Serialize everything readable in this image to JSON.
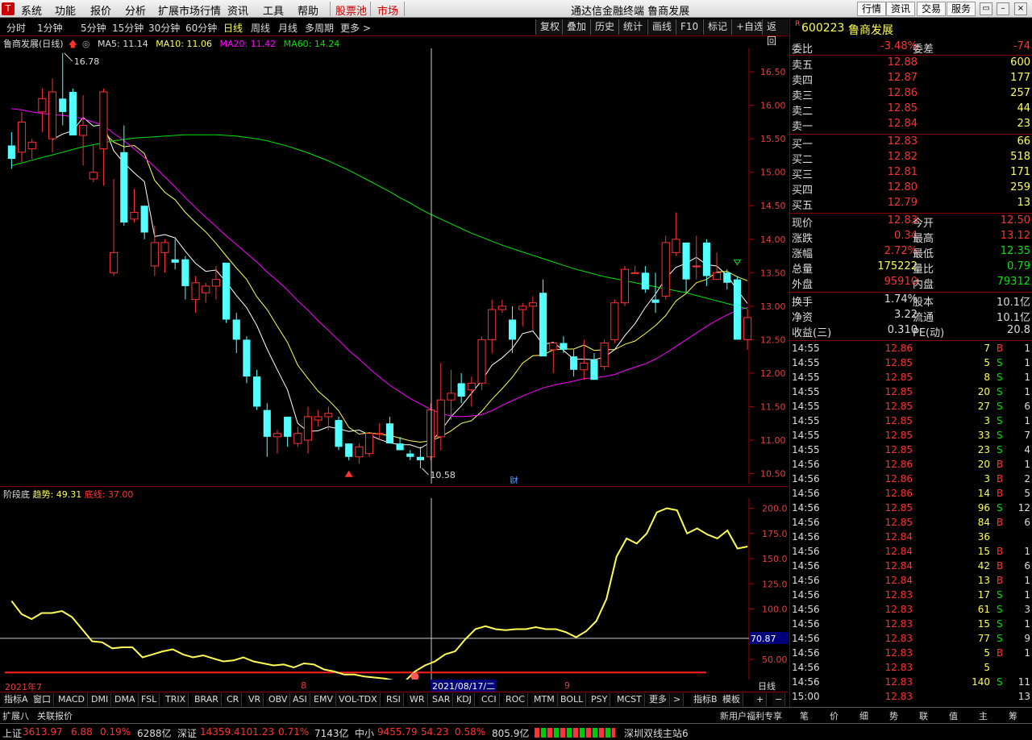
{
  "menu": {
    "items": [
      "系统",
      "功能",
      "报价",
      "分析",
      "扩展市场行情",
      "资讯",
      "工具",
      "帮助"
    ],
    "hl": [
      "股票池",
      "市场"
    ],
    "app_title": "通达信金融终端  鲁商发展",
    "right_btns": [
      "行情",
      "资讯",
      "交易",
      "服务"
    ]
  },
  "periods": [
    "分时",
    "1分钟",
    "5分钟",
    "15分钟",
    "30分钟",
    "60分钟",
    "日线",
    "周线",
    "月线",
    "多周期",
    "更多 >"
  ],
  "tools": [
    "复权",
    "叠加",
    "历史",
    "统计",
    "画线",
    "F10",
    "标记",
    "+自选",
    "返回"
  ],
  "legend": {
    "name": "鲁商发展(日线)",
    "ma5": "MA5: 11.14",
    "ma10": "MA10: 11.06",
    "ma20": "MA20: 11.42",
    "ma60": "MA60: 14.24"
  },
  "kaxis": [
    "16.50",
    "16.00",
    "15.50",
    "15.00",
    "14.50",
    "14.00",
    "13.50",
    "13.00",
    "12.50",
    "12.00",
    "11.50",
    "11.00",
    "10.50"
  ],
  "ann": {
    "high": "16.78",
    "low": "10.58",
    "cai": "财"
  },
  "ind": {
    "name": "阶段底",
    "trend": "趋势: 49.31",
    "base": "底线: 37.00",
    "axis": [
      "200.0",
      "175.0",
      "150.0",
      "125.0",
      "100.0",
      "50.00"
    ],
    "cur": "70.87"
  },
  "xaxis": {
    "a": "2021年7",
    "b": "8",
    "c": "9",
    "cursor": "2021/08/17/二",
    "period": "日线"
  },
  "bottom_tabs": [
    "指标A",
    "窗口",
    "MACD",
    "DMI",
    "DMA",
    "FSL",
    "TRIX",
    "BRAR",
    "CR",
    "VR",
    "OBV",
    "ASI",
    "EMV",
    "VOL-TDX",
    "RSI",
    "WR",
    "SAR",
    "KDJ",
    "CCI",
    "ROC",
    "MTM",
    "BOLL",
    "PSY",
    "MCST",
    "更多",
    "指标B",
    "模板"
  ],
  "status_tabs": [
    "扩展八",
    "关联报价",
    "新用户福利专享",
    "笔",
    "价",
    "细",
    "势",
    "联",
    "值",
    "主",
    "筹"
  ],
  "index_bar": [
    {
      "n": "上证",
      "v": "3613.97",
      "c": "6.88",
      "p": "0.19%",
      "a": "6288亿"
    },
    {
      "n": "深证",
      "v": "14359.4",
      "c": "101.23",
      "p": "0.71%",
      "a": "7143亿"
    },
    {
      "n": "中小",
      "v": "9455.79",
      "c": "54.23",
      "p": "0.58%",
      "a": "805.9亿"
    }
  ],
  "server": "深圳双线主站6",
  "stock": {
    "code": "600223",
    "name": "鲁商发展",
    "r": "R"
  },
  "wei": {
    "l": "委比",
    "v": "-3.48%",
    "l2": "委差",
    "v2": "-74"
  },
  "asks": [
    {
      "l": "卖五",
      "p": "12.88",
      "q": "600"
    },
    {
      "l": "卖四",
      "p": "12.87",
      "q": "177"
    },
    {
      "l": "卖三",
      "p": "12.86",
      "q": "257"
    },
    {
      "l": "卖二",
      "p": "12.85",
      "q": "44"
    },
    {
      "l": "卖一",
      "p": "12.84",
      "q": "23"
    }
  ],
  "bids": [
    {
      "l": "买一",
      "p": "12.83",
      "q": "66"
    },
    {
      "l": "买二",
      "p": "12.82",
      "q": "518"
    },
    {
      "l": "买三",
      "p": "12.81",
      "q": "171"
    },
    {
      "l": "买四",
      "p": "12.80",
      "q": "259"
    },
    {
      "l": "买五",
      "p": "12.79",
      "q": "13"
    }
  ],
  "quote": [
    {
      "l": "现价",
      "v": "12.83",
      "c": "red",
      "l2": "今开",
      "v2": "12.50",
      "c2": "red"
    },
    {
      "l": "涨跌",
      "v": "0.34",
      "c": "red",
      "l2": "最高",
      "v2": "13.12",
      "c2": "red"
    },
    {
      "l": "涨幅",
      "v": "2.72%",
      "c": "red",
      "l2": "最低",
      "v2": "12.35",
      "c2": "green"
    },
    {
      "l": "总量",
      "v": "175222",
      "c": "yel",
      "l2": "量比",
      "v2": "0.79",
      "c2": "green"
    },
    {
      "l": "外盘",
      "v": "95910",
      "c": "red",
      "l2": "内盘",
      "v2": "79312",
      "c2": "green"
    }
  ],
  "fin": [
    {
      "l": "换手",
      "v": "1.74%",
      "l2": "股本",
      "v2": "10.1亿"
    },
    {
      "l": "净资",
      "v": "3.22",
      "l2": "流通",
      "v2": "10.1亿"
    },
    {
      "l": "收益(三)",
      "v": "0.310",
      "l2": "PE(动)",
      "v2": "20.8"
    }
  ],
  "ticks": [
    [
      "14:55",
      "12.86",
      "7",
      "B",
      "1"
    ],
    [
      "14:55",
      "12.85",
      "5",
      "S",
      "1"
    ],
    [
      "14:55",
      "12.85",
      "8",
      "S",
      "1"
    ],
    [
      "14:55",
      "12.85",
      "20",
      "S",
      "1"
    ],
    [
      "14:55",
      "12.85",
      "27",
      "S",
      "6"
    ],
    [
      "14:55",
      "12.85",
      "3",
      "S",
      "1"
    ],
    [
      "14:55",
      "12.85",
      "33",
      "S",
      "7"
    ],
    [
      "14:55",
      "12.85",
      "23",
      "S",
      "4"
    ],
    [
      "14:56",
      "12.86",
      "20",
      "B",
      "1"
    ],
    [
      "14:56",
      "12.86",
      "3",
      "B",
      "2"
    ],
    [
      "14:56",
      "12.86",
      "14",
      "B",
      "5"
    ],
    [
      "14:56",
      "12.85",
      "96",
      "S",
      "12"
    ],
    [
      "14:56",
      "12.85",
      "84",
      "B",
      "6"
    ],
    [
      "14:56",
      "12.84",
      "36",
      "",
      ""
    ],
    [
      "14:56",
      "12.84",
      "15",
      "B",
      "1"
    ],
    [
      "14:56",
      "12.84",
      "42",
      "B",
      "6"
    ],
    [
      "14:56",
      "12.84",
      "13",
      "B",
      "1"
    ],
    [
      "14:56",
      "12.83",
      "17",
      "S",
      "1"
    ],
    [
      "14:56",
      "12.83",
      "61",
      "S",
      "3"
    ],
    [
      "14:56",
      "12.83",
      "15",
      "S",
      "1"
    ],
    [
      "14:56",
      "12.83",
      "77",
      "S",
      "9"
    ],
    [
      "14:56",
      "12.83",
      "5",
      "B",
      "1"
    ],
    [
      "14:56",
      "12.83",
      "5",
      "",
      ""
    ],
    [
      "14:56",
      "12.83",
      "140",
      "S",
      "11"
    ],
    [
      "15:00",
      "12.83",
      "",
      "",
      "13"
    ]
  ],
  "chart_data": [
    {
      "type": "candlestick",
      "title": "鲁商发展(日线)",
      "ylim": [
        10.35,
        16.85
      ],
      "candles": [
        [
          15.4,
          15.6,
          15.05,
          15.2
        ],
        [
          15.3,
          15.9,
          15.15,
          15.75
        ],
        [
          15.35,
          15.5,
          15.2,
          15.45
        ],
        [
          15.9,
          16.25,
          15.6,
          16.1
        ],
        [
          15.5,
          16.4,
          15.3,
          16.2
        ],
        [
          16.1,
          16.78,
          15.7,
          15.9
        ],
        [
          16.2,
          16.25,
          15.6,
          15.55
        ],
        [
          15.55,
          16.15,
          15.1,
          15.7
        ],
        [
          14.9,
          15.4,
          14.85,
          15.0
        ],
        [
          15.35,
          16.25,
          14.8,
          16.2
        ],
        [
          13.5,
          14.9,
          13.45,
          13.8
        ],
        [
          15.3,
          15.7,
          14.2,
          14.25
        ],
        [
          14.3,
          14.75,
          14.25,
          14.4
        ],
        [
          14.5,
          14.5,
          14.0,
          14.1
        ],
        [
          13.6,
          14.2,
          13.45,
          13.95
        ],
        [
          13.8,
          14.0,
          13.5,
          13.95
        ],
        [
          13.7,
          14.0,
          13.55,
          13.65
        ],
        [
          13.7,
          13.75,
          13.1,
          13.3
        ],
        [
          13.1,
          13.45,
          12.9,
          13.35
        ],
        [
          13.2,
          13.35,
          13.05,
          13.3
        ],
        [
          13.3,
          13.6,
          13.1,
          13.4
        ],
        [
          13.65,
          13.65,
          12.75,
          12.8
        ],
        [
          12.8,
          12.9,
          12.3,
          12.5
        ],
        [
          12.5,
          12.55,
          11.85,
          11.95
        ],
        [
          11.95,
          12.05,
          11.45,
          11.5
        ],
        [
          11.45,
          11.55,
          10.75,
          11.05
        ],
        [
          11.05,
          11.15,
          10.8,
          11.1
        ],
        [
          11.35,
          11.3,
          10.9,
          11.05
        ],
        [
          10.95,
          11.2,
          10.9,
          11.1
        ],
        [
          11.0,
          11.5,
          10.8,
          11.35
        ],
        [
          11.3,
          11.45,
          11.2,
          11.35
        ],
        [
          11.35,
          11.5,
          11.15,
          11.4
        ],
        [
          11.3,
          11.35,
          10.85,
          10.9
        ],
        [
          10.95,
          10.95,
          10.7,
          10.75
        ],
        [
          10.75,
          10.95,
          10.65,
          10.9
        ],
        [
          10.8,
          11.1,
          10.75,
          11.1
        ],
        [
          11.1,
          11.25,
          11.0,
          11.1
        ],
        [
          11.25,
          11.35,
          10.95,
          10.95
        ],
        [
          10.95,
          11.05,
          10.85,
          10.85
        ],
        [
          10.8,
          10.85,
          10.7,
          10.75
        ],
        [
          10.75,
          10.9,
          10.58,
          10.7
        ],
        [
          10.75,
          11.55,
          10.7,
          11.45
        ],
        [
          11.05,
          12.15,
          10.85,
          11.6
        ],
        [
          11.6,
          12.05,
          11.3,
          11.7
        ],
        [
          11.85,
          12.0,
          11.55,
          11.65
        ],
        [
          11.75,
          11.95,
          11.5,
          11.85
        ],
        [
          11.85,
          12.55,
          11.75,
          12.5
        ],
        [
          12.5,
          13.1,
          12.3,
          12.95
        ],
        [
          12.95,
          13.1,
          12.9,
          13.0
        ],
        [
          12.8,
          13.0,
          12.3,
          12.5
        ],
        [
          12.95,
          13.05,
          12.7,
          13.0
        ],
        [
          13.0,
          13.15,
          12.65,
          13.05
        ],
        [
          13.2,
          13.4,
          12.3,
          12.25
        ],
        [
          12.35,
          12.45,
          12.0,
          12.45
        ],
        [
          12.45,
          12.55,
          12.3,
          12.35
        ],
        [
          12.25,
          12.35,
          11.95,
          12.05
        ],
        [
          12.05,
          12.5,
          11.9,
          12.15
        ],
        [
          12.2,
          12.3,
          11.95,
          11.9
        ],
        [
          12.1,
          12.5,
          12.05,
          12.45
        ],
        [
          12.5,
          13.1,
          12.45,
          13.05
        ],
        [
          13.05,
          13.6,
          13.0,
          13.55
        ],
        [
          13.5,
          13.6,
          13.5,
          13.5
        ],
        [
          13.5,
          13.6,
          13.2,
          13.25
        ],
        [
          13.1,
          13.5,
          12.9,
          13.05
        ],
        [
          13.15,
          14.05,
          13.1,
          13.95
        ],
        [
          13.8,
          14.4,
          13.75,
          14.0
        ],
        [
          13.95,
          13.95,
          13.2,
          13.4
        ],
        [
          13.6,
          14.05,
          13.4,
          13.6
        ],
        [
          13.95,
          14.0,
          13.3,
          13.45
        ],
        [
          13.4,
          13.8,
          13.4,
          13.5
        ],
        [
          13.5,
          13.55,
          13.25,
          13.35
        ],
        [
          13.4,
          13.45,
          12.5,
          12.5
        ],
        [
          12.5,
          12.95,
          12.35,
          12.83
        ]
      ],
      "series": [
        {
          "name": "MA5",
          "color": "#ffffff",
          "values": [
            null,
            null,
            null,
            null,
            15.49,
            15.57,
            15.62,
            15.82,
            15.69,
            15.71,
            15.32,
            15.14,
            14.99,
            14.86,
            14.04,
            14.07,
            14.02,
            13.82,
            13.64,
            13.52,
            13.54,
            13.36,
            13.16,
            12.98,
            12.71,
            12.36,
            12.05,
            11.75,
            11.25,
            11.13,
            11.14,
            11.2,
            11.17,
            11.13,
            11.15,
            11.08,
            11.01,
            10.96,
            10.93,
            10.93,
            10.88,
            10.97,
            11.14,
            11.35,
            11.51,
            11.7,
            11.89,
            12.12,
            12.23,
            12.37,
            12.59,
            12.63,
            12.43,
            12.46,
            12.34,
            12.21,
            12.21,
            12.2,
            12.24,
            12.35,
            12.56,
            12.74,
            12.98,
            13.18,
            13.42,
            13.58,
            13.64,
            13.73,
            13.62,
            13.6,
            13.46,
            13.24,
            13.04
          ]
        },
        {
          "name": "MA10",
          "color": "#ffff54",
          "values": [
            null,
            null,
            null,
            null,
            null,
            null,
            null,
            null,
            null,
            15.6,
            15.45,
            15.38,
            15.4,
            15.28,
            14.88,
            14.7,
            14.59,
            14.4,
            14.25,
            14.11,
            13.94,
            13.75,
            13.57,
            13.4,
            13.14,
            12.95,
            12.7,
            12.46,
            12.12,
            11.92,
            11.73,
            11.6,
            11.44,
            11.19,
            11.09,
            11.11,
            11.09,
            11.07,
            11.03,
            10.99,
            10.97,
            10.99,
            11.05,
            11.14,
            11.25,
            11.29,
            11.43,
            11.61,
            11.77,
            11.94,
            12.15,
            12.26,
            12.27,
            12.35,
            12.36,
            12.36,
            12.42,
            12.34,
            12.35,
            12.35,
            12.43,
            12.48,
            12.59,
            12.71,
            12.86,
            13.08,
            13.19,
            13.35,
            13.4,
            13.51,
            13.52,
            13.44,
            13.38
          ]
        },
        {
          "name": "MA20",
          "color": "#ff00ff",
          "values": [
            15.95,
            15.93,
            15.9,
            15.88,
            15.86,
            15.85,
            15.83,
            15.8,
            15.75,
            15.7,
            15.58,
            15.47,
            15.35,
            15.22,
            15.08,
            14.93,
            14.78,
            14.62,
            14.47,
            14.33,
            14.19,
            14.05,
            13.92,
            13.79,
            13.66,
            13.51,
            13.38,
            13.24,
            13.08,
            12.94,
            12.78,
            12.64,
            12.49,
            12.34,
            12.21,
            12.07,
            11.94,
            11.82,
            11.72,
            11.62,
            11.54,
            11.46,
            11.4,
            11.36,
            11.35,
            11.36,
            11.38,
            11.44,
            11.52,
            11.59,
            11.66,
            11.72,
            11.78,
            11.82,
            11.85,
            11.88,
            11.92,
            11.93,
            11.95,
            11.98,
            12.04,
            12.09,
            12.14,
            12.21,
            12.3,
            12.4,
            12.5,
            12.6,
            12.7,
            12.79,
            12.87,
            12.94,
            12.98
          ]
        },
        {
          "name": "MA60",
          "color": "#00e600",
          "values": [
            15.1,
            15.14,
            15.18,
            15.22,
            15.26,
            15.3,
            15.34,
            15.38,
            15.41,
            15.44,
            15.47,
            15.49,
            15.51,
            15.52,
            15.53,
            15.54,
            15.55,
            15.56,
            15.56,
            15.56,
            15.56,
            15.55,
            15.54,
            15.52,
            15.5,
            15.47,
            15.43,
            15.39,
            15.34,
            15.29,
            15.23,
            15.17,
            15.1,
            15.03,
            14.95,
            14.87,
            14.79,
            14.71,
            14.62,
            14.54,
            14.45,
            14.37,
            14.3,
            14.23,
            14.16,
            14.09,
            14.03,
            13.97,
            13.91,
            13.86,
            13.81,
            13.76,
            13.71,
            13.66,
            13.61,
            13.56,
            13.52,
            13.48,
            13.44,
            13.41,
            13.38,
            13.35,
            13.32,
            13.29,
            13.26,
            13.23,
            13.2,
            13.16,
            13.12,
            13.08,
            13.04,
            13.0,
            12.96
          ]
        }
      ]
    },
    {
      "type": "line",
      "title": "阶段底",
      "ylim": [
        30,
        210
      ],
      "series": [
        {
          "name": "趋势",
          "color": "#ffff54",
          "values": [
            108,
            95,
            90,
            96,
            96,
            98,
            92,
            80,
            68,
            67,
            61,
            62,
            62,
            52,
            55,
            58,
            60,
            55,
            52,
            54,
            51,
            48,
            49,
            52,
            48,
            46,
            44,
            45,
            42,
            46,
            45,
            40,
            38,
            35,
            35,
            33,
            32,
            31,
            29,
            28,
            38,
            44,
            48,
            55,
            58,
            70,
            80,
            83,
            80,
            79,
            80,
            80,
            82,
            80,
            80,
            77,
            72,
            78,
            88,
            110,
            152,
            170,
            165,
            175,
            196,
            200,
            198,
            175,
            180,
            174,
            170,
            178,
            160,
            162
          ]
        },
        {
          "name": "底线",
          "color": "#ff2020",
          "values": [
            37,
            37
          ]
        }
      ]
    }
  ]
}
